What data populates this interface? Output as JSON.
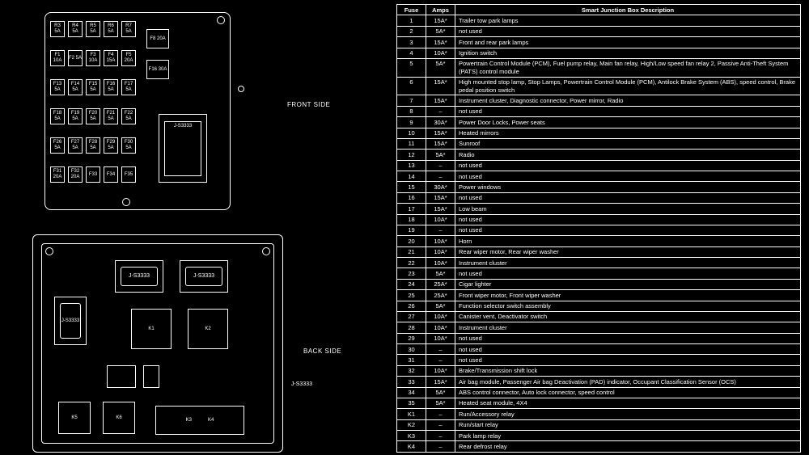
{
  "labels": {
    "front_side": "FRONT SIDE",
    "back_side": "BACK SIDE"
  },
  "top_box": {
    "rows": [
      [
        "R3 5A",
        "R4 5A",
        "R5 5A",
        "R6 5A",
        "R7 5A"
      ],
      [
        "F1 10A",
        "F2 5A",
        "F3 10A",
        "F4 15A",
        "F5 20A"
      ],
      [
        "F13 5A",
        "F14 5A",
        "F15 5A",
        "F16 5A",
        "F17 5A"
      ],
      [
        "F18 5A",
        "F19 5A",
        "F20 5A",
        "F21 5A",
        "F22 5A"
      ],
      [
        "F26 5A",
        "F27 5A",
        "F28 5A",
        "F29 5A",
        "F30 5A"
      ],
      [
        "F31 20A",
        "F32 20A",
        "F33",
        "F34",
        "F35"
      ]
    ],
    "side_slots": [
      "F8 20A",
      "F16 30A"
    ],
    "relay": "J-S3333"
  },
  "bottom_box": {
    "relays": [
      "J-S3333",
      "J-S3333",
      "J-S3333",
      "J-S3333"
    ],
    "blocks": [
      "K1",
      "K2",
      "K3",
      "K4",
      "K5",
      "K6"
    ]
  },
  "table": {
    "headers": [
      "Fuse",
      "Amps",
      "Smart Junction Box Description"
    ],
    "rows": [
      {
        "fuse": "1",
        "amps": "15A*",
        "desc": "Trailer tow park lamps"
      },
      {
        "fuse": "2",
        "amps": "5A*",
        "desc": "not used"
      },
      {
        "fuse": "3",
        "amps": "15A*",
        "desc": "Front and rear park lamps"
      },
      {
        "fuse": "4",
        "amps": "10A*",
        "desc": "Ignition switch"
      },
      {
        "fuse": "5",
        "amps": "5A*",
        "desc": "Powertrain Control Module (PCM), Fuel pump relay, Main fan relay, High/Low speed fan relay 2, Passive Anti-Theft System (PATS) control module"
      },
      {
        "fuse": "6",
        "amps": "15A*",
        "desc": "High mounted stop lamp, Stop Lamps, Powertrain Control Module (PCM), Antilock Brake System (ABS), speed control, Brake pedal position switch"
      },
      {
        "fuse": "7",
        "amps": "15A*",
        "desc": "Instrument cluster, Diagnostic connector, Power mirror, Radio"
      },
      {
        "fuse": "8",
        "amps": "–",
        "desc": "not used"
      },
      {
        "fuse": "9",
        "amps": "30A*",
        "desc": "Power Door Locks, Power seats"
      },
      {
        "fuse": "10",
        "amps": "15A*",
        "desc": "Heated mirrors"
      },
      {
        "fuse": "11",
        "amps": "15A*",
        "desc": "Sunroof"
      },
      {
        "fuse": "12",
        "amps": "5A*",
        "desc": "Radio"
      },
      {
        "fuse": "13",
        "amps": "–",
        "desc": "not used"
      },
      {
        "fuse": "14",
        "amps": "–",
        "desc": "not used"
      },
      {
        "fuse": "15",
        "amps": "30A*",
        "desc": "Power windows"
      },
      {
        "fuse": "16",
        "amps": "15A*",
        "desc": "not used"
      },
      {
        "fuse": "17",
        "amps": "15A*",
        "desc": "Low beam"
      },
      {
        "fuse": "18",
        "amps": "10A*",
        "desc": "not used"
      },
      {
        "fuse": "19",
        "amps": "–",
        "desc": "not used"
      },
      {
        "fuse": "20",
        "amps": "10A*",
        "desc": "Horn"
      },
      {
        "fuse": "21",
        "amps": "10A*",
        "desc": "Rear wiper motor, Rear wiper washer"
      },
      {
        "fuse": "22",
        "amps": "10A*",
        "desc": "Instrument cluster"
      },
      {
        "fuse": "23",
        "amps": "5A*",
        "desc": "not used"
      },
      {
        "fuse": "24",
        "amps": "25A*",
        "desc": "Cigar lighter"
      },
      {
        "fuse": "25",
        "amps": "25A*",
        "desc": "Front wiper motor, Front wiper washer"
      },
      {
        "fuse": "26",
        "amps": "5A*",
        "desc": "Function selector switch assembly"
      },
      {
        "fuse": "27",
        "amps": "10A*",
        "desc": "Canister vent, Deactivator switch"
      },
      {
        "fuse": "28",
        "amps": "10A*",
        "desc": "Instrument cluster"
      },
      {
        "fuse": "29",
        "amps": "10A*",
        "desc": "not used"
      },
      {
        "fuse": "30",
        "amps": "–",
        "desc": "not used"
      },
      {
        "fuse": "31",
        "amps": "–",
        "desc": "not used"
      },
      {
        "fuse": "32",
        "amps": "10A*",
        "desc": "Brake/Transmission shift lock"
      },
      {
        "fuse": "33",
        "amps": "15A*",
        "desc": "Air bag module, Passenger Air bag Deactivation (PAD) indicator, Occupant Classification Sensor (OCS)"
      },
      {
        "fuse": "34",
        "amps": "5A*",
        "desc": "ABS control connector, Auto lock connector, speed control"
      },
      {
        "fuse": "35",
        "amps": "5A*",
        "desc": "Heated seat module, 4X4"
      },
      {
        "fuse": "K1",
        "amps": "–",
        "desc": "Run/Accessory relay"
      },
      {
        "fuse": "K2",
        "amps": "–",
        "desc": "Run/start relay"
      },
      {
        "fuse": "K3",
        "amps": "–",
        "desc": "Park lamp relay"
      },
      {
        "fuse": "K4",
        "amps": "–",
        "desc": "Rear defrost relay"
      }
    ]
  }
}
